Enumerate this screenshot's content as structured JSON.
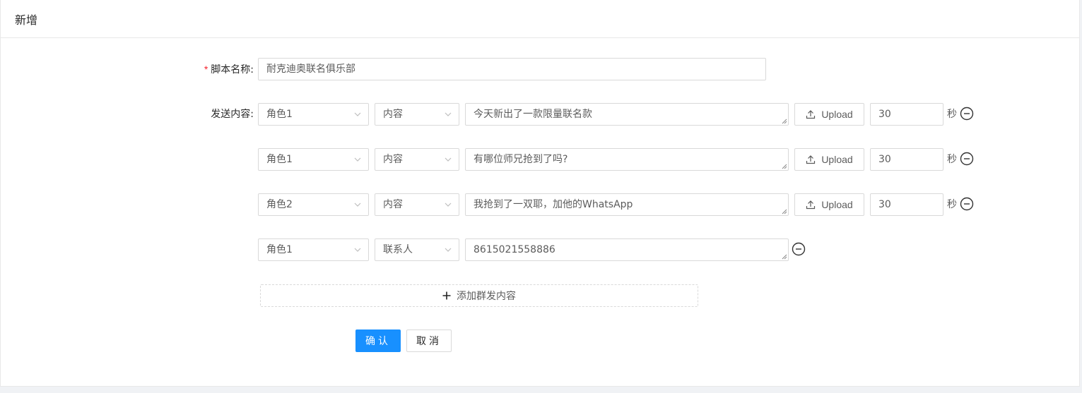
{
  "header": {
    "title": "新增"
  },
  "form": {
    "name_label": "脚本名称:",
    "name_required": "*",
    "name_value": "耐克迪奥联名俱乐部",
    "content_label": "发送内容:",
    "rows": [
      {
        "role": "角色1",
        "type": "内容",
        "text": "今天新出了一款限量联名款",
        "upload": "Upload",
        "seconds": "30",
        "unit": "秒"
      },
      {
        "role": "角色1",
        "type": "内容",
        "text": "有哪位师兄抢到了吗?",
        "upload": "Upload",
        "seconds": "30",
        "unit": "秒"
      },
      {
        "role": "角色2",
        "type": "内容",
        "text": "我抢到了一双耶，加他的WhatsApp",
        "upload": "Upload",
        "seconds": "30",
        "unit": "秒"
      },
      {
        "role": "角色1",
        "type": "联系人",
        "text": "8615021558886"
      }
    ],
    "add_label": "添加群发内容",
    "confirm_label": "确认",
    "cancel_label": "取消"
  },
  "colors": {
    "primary": "#1890ff",
    "required": "#f5222d",
    "border": "#d9d9d9"
  },
  "icons": [
    "chevron-down-icon",
    "upload-icon",
    "minus-circle-icon",
    "plus-icon",
    "resize-grip-icon"
  ]
}
